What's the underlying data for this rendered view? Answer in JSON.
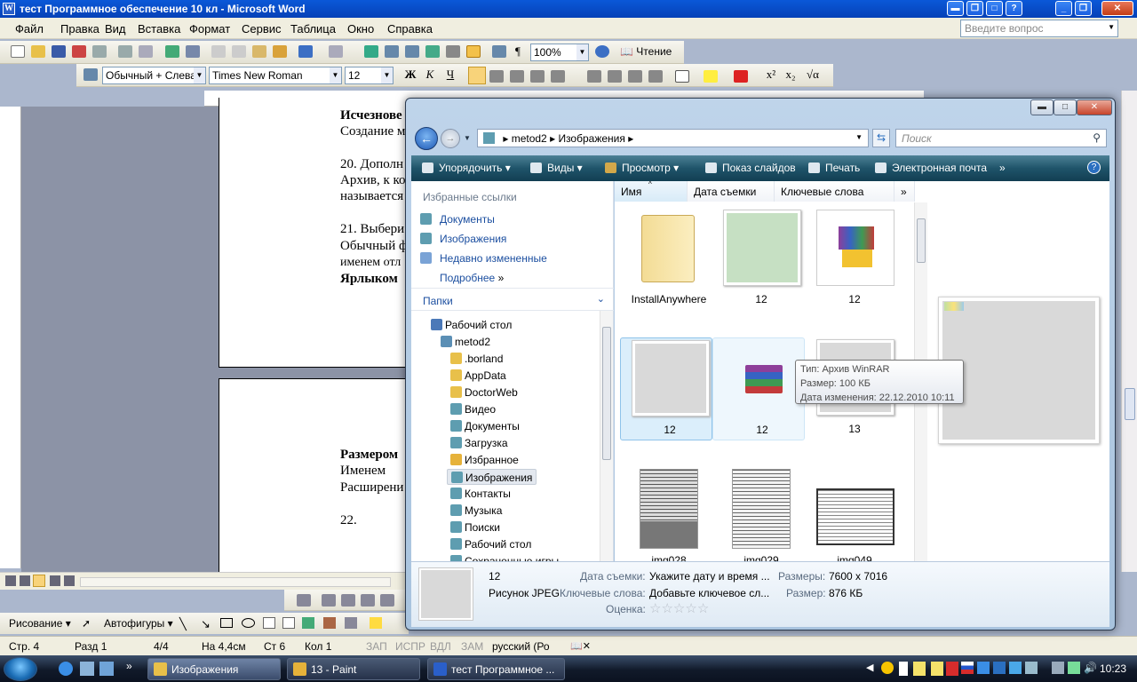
{
  "word": {
    "title": "тест Программное обеспечение 10 кл - Microsoft Word",
    "menu": [
      "Файл",
      "Правка",
      "Вид",
      "Вставка",
      "Формат",
      "Сервис",
      "Таблица",
      "Окно",
      "Справка"
    ],
    "ask_placeholder": "Введите вопрос",
    "zoom": "100%",
    "reading_label": "Чтение",
    "style_combo": "Обычный + Слева",
    "font_combo": "Times New Roman",
    "size_combo": "12",
    "document_lines": [
      {
        "text": "Исчезнове",
        "bold": true
      },
      {
        "text": "Создание м",
        "bold": false
      },
      {
        "text": "20. Дополн",
        "bold": false
      },
      {
        "text": "Архив, к ко",
        "bold": false
      },
      {
        "text": "называется",
        "bold": false
      },
      {
        "text": "21. Выбери",
        "bold": false
      },
      {
        "text": "Обычный ф",
        "bold": false
      },
      {
        "text": "именем отл",
        "bold": false
      },
      {
        "text": "Ярлыком",
        "bold": true
      },
      {
        "text": "Размером",
        "bold": true
      },
      {
        "text": "Именем",
        "bold": false
      },
      {
        "text": "Расширени",
        "bold": false
      },
      {
        "text": "22.",
        "bold": false
      }
    ],
    "drawing_label": "Рисование",
    "autoshapes_label": "Автофигуры",
    "status": {
      "page": "Стр. 4",
      "section": "Разд 1",
      "pages": "4/4",
      "at": "На 4,4см",
      "line": "Ст 6",
      "col": "Кол 1",
      "rec": "ЗАП",
      "trk": "ИСПР",
      "ext": "ВДЛ",
      "ovr": "ЗАМ",
      "lang": "русский (Ро"
    }
  },
  "explorer": {
    "address": [
      "metod2",
      "Изображения"
    ],
    "search_placeholder": "Поиск",
    "commands": {
      "organize": "Упорядочить",
      "views": "Виды",
      "preview": "Просмотр",
      "slideshow": "Показ слайдов",
      "print": "Печать",
      "email": "Электронная почта",
      "more": "»"
    },
    "favorites_title": "Избранные ссылки",
    "favorites": [
      "Документы",
      "Изображения",
      "Недавно измененные"
    ],
    "more_link": "Подробнее",
    "folders_title": "Папки",
    "tree": [
      {
        "label": "Рабочий стол",
        "level": 0,
        "color": "#4b79b8"
      },
      {
        "label": "metod2",
        "level": 1,
        "color": "#5b8fb5"
      },
      {
        "label": ".borland",
        "level": 2,
        "color": "#e8c04a"
      },
      {
        "label": "AppData",
        "level": 2,
        "color": "#e8c04a"
      },
      {
        "label": "DoctorWeb",
        "level": 2,
        "color": "#e8c04a"
      },
      {
        "label": "Видео",
        "level": 2,
        "color": "#5e9db0"
      },
      {
        "label": "Документы",
        "level": 2,
        "color": "#5e9db0"
      },
      {
        "label": "Загрузка",
        "level": 2,
        "color": "#5e9db0"
      },
      {
        "label": "Избранное",
        "level": 2,
        "color": "#e6b23a"
      },
      {
        "label": "Изображения",
        "level": 2,
        "color": "#5e9db0",
        "selected": true
      },
      {
        "label": "Контакты",
        "level": 2,
        "color": "#5e9db0"
      },
      {
        "label": "Музыка",
        "level": 2,
        "color": "#5e9db0"
      },
      {
        "label": "Поиски",
        "level": 2,
        "color": "#5e9db0"
      },
      {
        "label": "Рабочий стол",
        "level": 2,
        "color": "#5e9db0"
      },
      {
        "label": "Сохраненные игры",
        "level": 2,
        "color": "#5e9db0"
      }
    ],
    "columns": [
      "Имя",
      "Дата съемки",
      "Ключевые слова",
      "»"
    ],
    "files": [
      {
        "name": "InstallAnywhere",
        "kind": "folder"
      },
      {
        "name": "12",
        "kind": "image-green"
      },
      {
        "name": "12",
        "kind": "winrar-installer"
      },
      {
        "name": "12",
        "kind": "image-gray",
        "selected": true
      },
      {
        "name": "12",
        "kind": "winrar-archive",
        "hover": true
      },
      {
        "name": "13",
        "kind": "image-gray"
      },
      {
        "name": "img028",
        "kind": "scan"
      },
      {
        "name": "img029",
        "kind": "scan-book"
      },
      {
        "name": "img049",
        "kind": "scan-open"
      }
    ],
    "tooltip": {
      "type": "Тип: Архив WinRAR",
      "size": "Размер: 100 КБ",
      "modified": "Дата изменения: 22.12.2010 10:11"
    },
    "details": {
      "name": "12",
      "filetype": "Рисунок JPEG",
      "date_label": "Дата съемки:",
      "date_value": "Укажите дату и время ...",
      "keywords_label": "Ключевые слова:",
      "keywords_value": "Добавьте ключевое сл...",
      "rating_label": "Оценка:",
      "rating": 0,
      "rating_max": 5,
      "dims_label": "Размеры:",
      "dims_value": "7600 x 7016",
      "size_label": "Размер:",
      "size_value": "876 КБ"
    }
  },
  "taskbar": {
    "tasks": [
      "Изображения",
      "13 - Paint",
      "тест Программное ..."
    ],
    "time": "10:23"
  }
}
